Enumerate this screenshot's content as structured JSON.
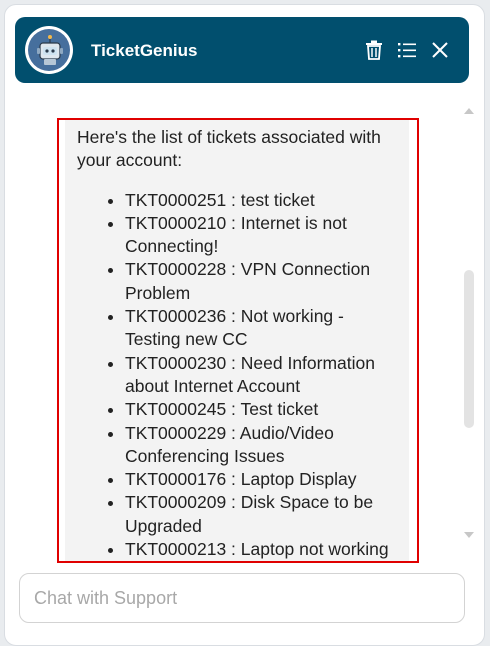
{
  "app": {
    "title": "TicketGenius"
  },
  "header_icons": {
    "delete": "trash-icon",
    "menu": "list-icon",
    "close": "close-icon"
  },
  "message": {
    "intro": "Here's the list of tickets associated with your account:",
    "tickets": [
      "TKT0000251 : test ticket",
      "TKT0000210 : Internet is not Connecting!",
      "TKT0000228 : VPN Connection Problem",
      "TKT0000236 : Not working - Testing new CC",
      "TKT0000230 : Need Information about Internet Account",
      "TKT0000245 : Test ticket",
      "TKT0000229 : Audio/Video Conferencing Issues",
      "TKT0000176 : Laptop Display",
      "TKT0000209 : Disk Space to be Upgraded",
      "TKT0000213 : Laptop not working"
    ]
  },
  "chat": {
    "placeholder": "Chat with Support"
  },
  "colors": {
    "header_bg": "#014f6e",
    "highlight_border": "#e00000",
    "bubble_bg": "#f3f3f3"
  }
}
